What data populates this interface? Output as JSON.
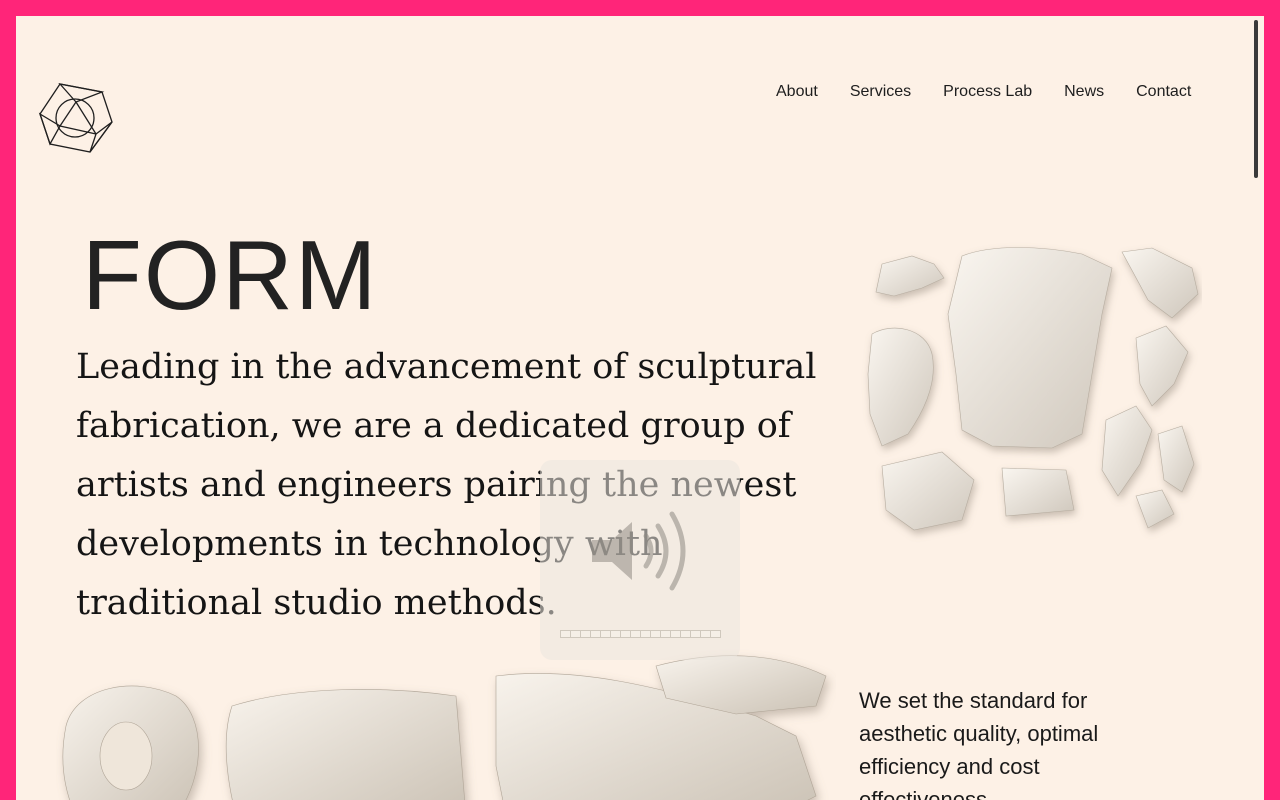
{
  "nav": {
    "items": [
      "About",
      "Services",
      "Process Lab",
      "News",
      "Contact"
    ]
  },
  "hero": {
    "title": "FORM",
    "body": "Leading in the advancement of sculptural fabrication, we are a dedicated group of artists and engineers pairing the newest developments in technology with traditional studio methods."
  },
  "side": {
    "text": "We set the standard for aesthetic quality, optimal efficiency and cost effectiveness."
  },
  "volume": {
    "segments": 16,
    "level": 0
  },
  "colors": {
    "frame": "#ff2579",
    "background": "#fdf1e6",
    "text": "#151515"
  },
  "icons": {
    "logo": "hexagon-cube-logo",
    "volume": "speaker-volume-icon"
  }
}
